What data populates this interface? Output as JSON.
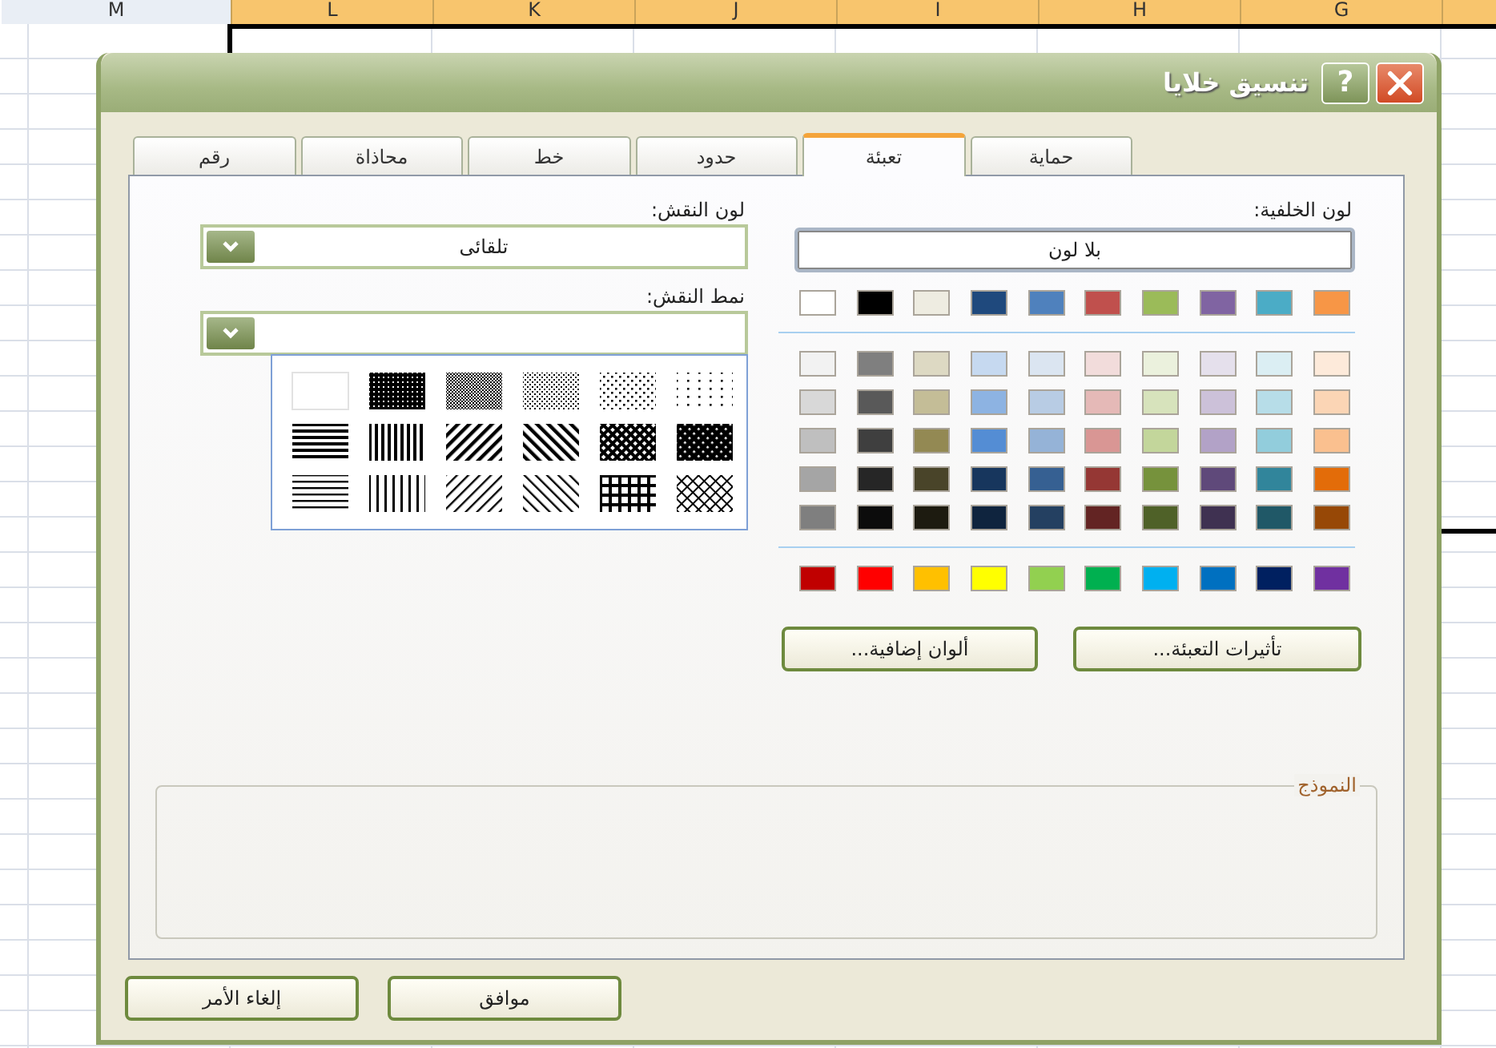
{
  "spreadsheet": {
    "columns": [
      {
        "label": "G",
        "selected": true
      },
      {
        "label": "H",
        "selected": true
      },
      {
        "label": "I",
        "selected": true
      },
      {
        "label": "J",
        "selected": true
      },
      {
        "label": "K",
        "selected": true
      },
      {
        "label": "L",
        "selected": true
      },
      {
        "label": "M",
        "selected": false
      }
    ]
  },
  "dialog": {
    "title": "تنسيق خلايا",
    "help": "?"
  },
  "tabs": [
    {
      "label": "حماية",
      "selected": false
    },
    {
      "label": "تعبئة",
      "selected": true
    },
    {
      "label": "حدود",
      "selected": false
    },
    {
      "label": "خط",
      "selected": false
    },
    {
      "label": "محاذاة",
      "selected": false
    },
    {
      "label": "رقم",
      "selected": false
    }
  ],
  "background_color": {
    "label": "لون الخلفية:",
    "no_color_button": "بلا لون",
    "theme_colors": [
      {
        "color": "#ffffff"
      },
      {
        "color": "#000000"
      },
      {
        "color": "#eeece1"
      },
      {
        "color": "#1f497d"
      },
      {
        "color": "#4f81bd"
      },
      {
        "color": "#c0504d"
      },
      {
        "color": "#9bbb59"
      },
      {
        "color": "#8064a2"
      },
      {
        "color": "#4bacc6"
      },
      {
        "color": "#f79646"
      }
    ],
    "tint_rows": [
      [
        {
          "color": "#f2f2f2"
        },
        {
          "color": "#7f7f7f"
        },
        {
          "color": "#ddd9c3"
        },
        {
          "color": "#c6d9f0"
        },
        {
          "color": "#dbe5f1"
        },
        {
          "color": "#f2dcdb"
        },
        {
          "color": "#ebf1dd"
        },
        {
          "color": "#e5e0ec"
        },
        {
          "color": "#dbeef3"
        },
        {
          "color": "#fdeada"
        }
      ],
      [
        {
          "color": "#d8d8d8"
        },
        {
          "color": "#595959"
        },
        {
          "color": "#c4bd97"
        },
        {
          "color": "#8db3e2"
        },
        {
          "color": "#b8cce4"
        },
        {
          "color": "#e5b9b7"
        },
        {
          "color": "#d7e3bc"
        },
        {
          "color": "#ccc1d9"
        },
        {
          "color": "#b7dde8"
        },
        {
          "color": "#fbd5b5"
        }
      ],
      [
        {
          "color": "#bfbfbf"
        },
        {
          "color": "#3f3f3f"
        },
        {
          "color": "#938953"
        },
        {
          "color": "#548dd4"
        },
        {
          "color": "#95b3d7"
        },
        {
          "color": "#d99694"
        },
        {
          "color": "#c3d69b"
        },
        {
          "color": "#b2a2c7"
        },
        {
          "color": "#92cddc"
        },
        {
          "color": "#fac08f"
        }
      ],
      [
        {
          "color": "#a5a5a5"
        },
        {
          "color": "#262626"
        },
        {
          "color": "#494429"
        },
        {
          "color": "#17365d"
        },
        {
          "color": "#366092"
        },
        {
          "color": "#953734"
        },
        {
          "color": "#76923c"
        },
        {
          "color": "#5f497a"
        },
        {
          "color": "#31859b"
        },
        {
          "color": "#e36c09"
        }
      ],
      [
        {
          "color": "#7f7f7f"
        },
        {
          "color": "#0c0c0c"
        },
        {
          "color": "#1d1b10"
        },
        {
          "color": "#0f243e"
        },
        {
          "color": "#244061"
        },
        {
          "color": "#632423"
        },
        {
          "color": "#4f6128"
        },
        {
          "color": "#3f3151"
        },
        {
          "color": "#205867"
        },
        {
          "color": "#974806"
        }
      ]
    ],
    "standard_colors": [
      {
        "color": "#c00000"
      },
      {
        "color": "#ff0000"
      },
      {
        "color": "#ffc000"
      },
      {
        "color": "#ffff00"
      },
      {
        "color": "#92d050"
      },
      {
        "color": "#00b050"
      },
      {
        "color": "#00b0f0"
      },
      {
        "color": "#0070c0"
      },
      {
        "color": "#002060"
      },
      {
        "color": "#7030a0"
      }
    ],
    "fill_effects_button": "تأثيرات التعبئة...",
    "more_colors_button": "ألوان إضافية..."
  },
  "pattern_color": {
    "label": "لون النقش:",
    "value": "تلقائى"
  },
  "pattern_style": {
    "label": "نمط النقش:",
    "expanded": true
  },
  "sample": {
    "label": "النموذج"
  },
  "buttons": [
    {
      "label": "موافق"
    },
    {
      "label": "إلغاء الأمر"
    }
  ]
}
